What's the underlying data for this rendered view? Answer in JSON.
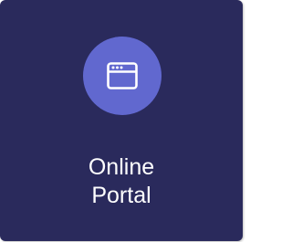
{
  "tile": {
    "icon": "browser-window-icon",
    "label_line1": "Online",
    "label_line2": "Portal"
  },
  "colors": {
    "card_background": "#2a2a5c",
    "icon_circle": "#6168cf",
    "text": "#ffffff"
  }
}
